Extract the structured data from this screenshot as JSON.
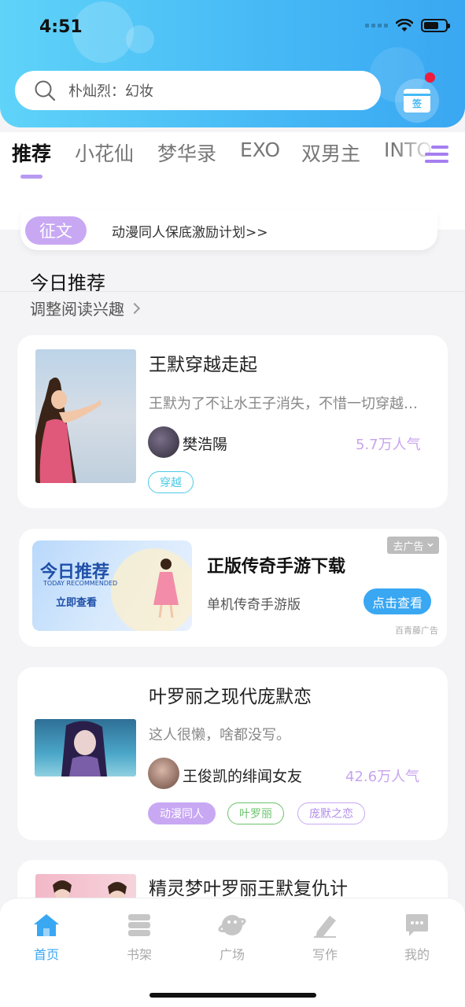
{
  "status_bar": {
    "time": "4:51"
  },
  "search": {
    "text": "朴灿烈：幻妆"
  },
  "checkin": {
    "label": "签"
  },
  "tabs": [
    "推荐",
    "小花仙",
    "梦华录",
    "EXO",
    "双男主",
    "INTO"
  ],
  "notice": {
    "badge": "征文",
    "text": "动漫同人保底激励计划>>"
  },
  "section": {
    "title": "今日推荐",
    "subtitle": "调整阅读兴趣"
  },
  "books": [
    {
      "title": "王默穿越走起",
      "desc": "王默为了不让水王子消失，不惜一切穿越…",
      "author": "樊浩陽",
      "popularity": "5.7万人气",
      "tags": [
        {
          "label": "穿越",
          "color": "#4cc9e6"
        }
      ]
    },
    {
      "title": "叶罗丽之现代庞默恋",
      "desc": "这人很懒，啥都没写。",
      "author": "王俊凯的绯闻女友",
      "popularity": "42.6万人气",
      "tags": [
        {
          "label": "动漫同人",
          "color": "#c8a8f3",
          "filled": true
        },
        {
          "label": "叶罗丽",
          "color": "#6cc36c"
        },
        {
          "label": "庞默之恋",
          "color": "#c8a8f3"
        }
      ]
    },
    {
      "title": "精灵梦叶罗丽王默复仇计"
    }
  ],
  "ad": {
    "image_title": "今日推荐",
    "image_subtitle": "TODAY RECOMMENDED",
    "image_cta": "立即查看",
    "title": "正版传奇手游下载",
    "subtitle": "单机传奇手游版",
    "button": "点击查看",
    "close_label": "去广告",
    "source": "百青藤广告"
  },
  "bottom_nav": [
    {
      "label": "首页",
      "icon": "home-icon",
      "active": true
    },
    {
      "label": "书架",
      "icon": "bookshelf-icon"
    },
    {
      "label": "广场",
      "icon": "planet-icon"
    },
    {
      "label": "写作",
      "icon": "pen-icon"
    },
    {
      "label": "我的",
      "icon": "chat-bubble-icon"
    }
  ],
  "colors": {
    "accent": "#3aa7f2",
    "purple": "#c8a8f3",
    "red_dot": "#f01c3c"
  }
}
